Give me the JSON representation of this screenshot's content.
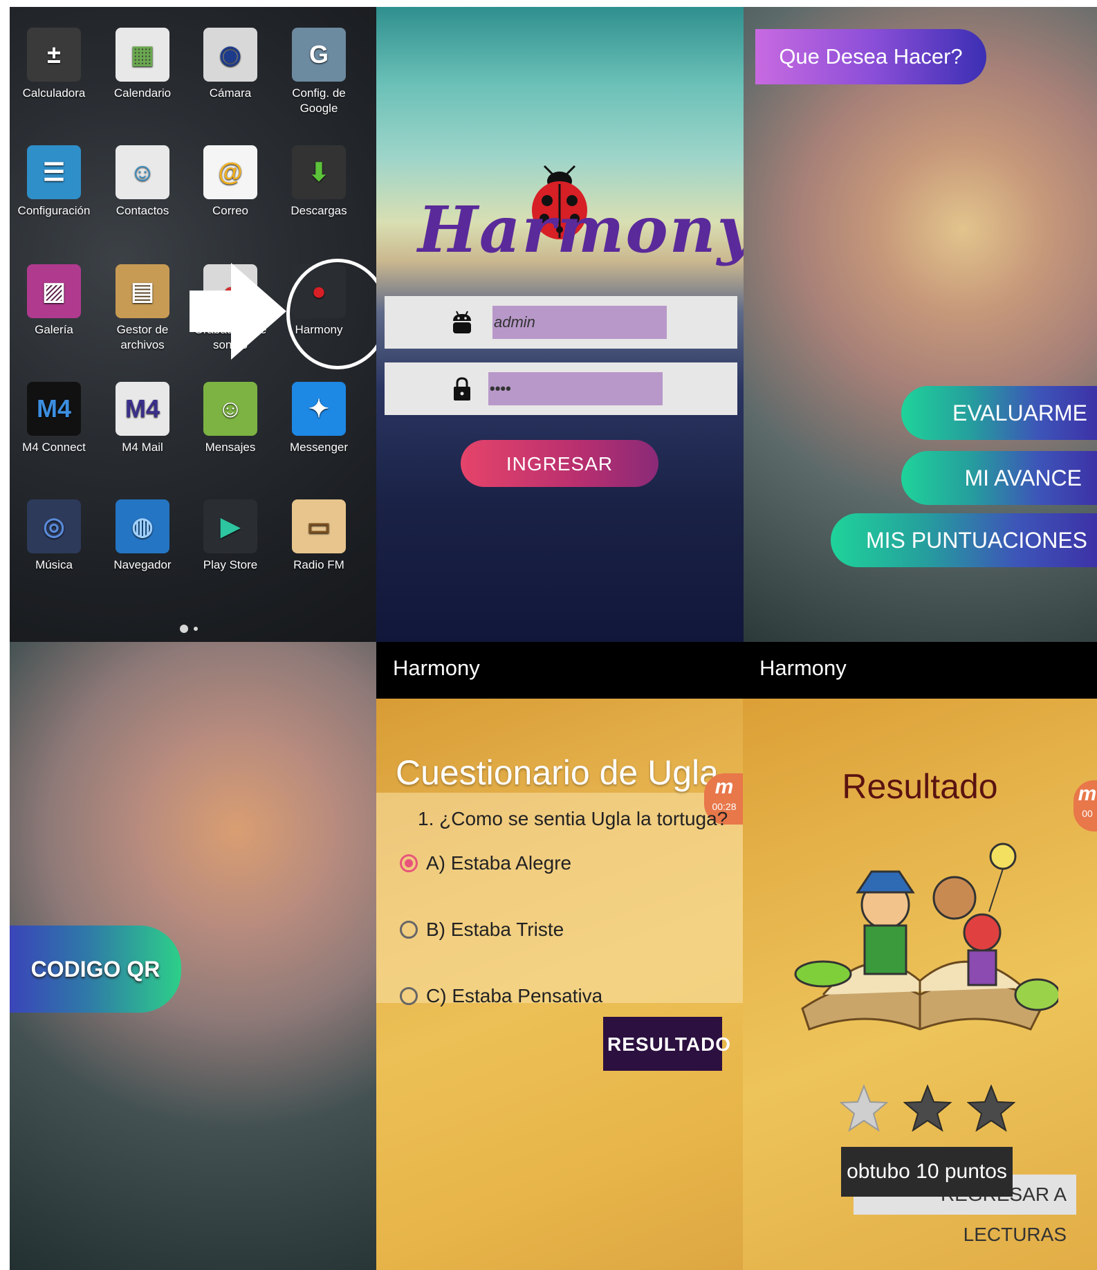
{
  "launcher": {
    "apps": [
      {
        "label": "Calculadora",
        "icon": "calculator-icon"
      },
      {
        "label": "Calendario",
        "icon": "calendar-icon"
      },
      {
        "label": "Cámara",
        "icon": "camera-icon"
      },
      {
        "label": "Config. de Google",
        "icon": "google-settings-icon"
      },
      {
        "label": "Configuración",
        "icon": "settings-icon"
      },
      {
        "label": "Contactos",
        "icon": "contacts-icon"
      },
      {
        "label": "Correo",
        "icon": "email-icon"
      },
      {
        "label": "Descargas",
        "icon": "downloads-icon"
      },
      {
        "label": "Galería",
        "icon": "gallery-icon"
      },
      {
        "label": "Gestor de archivos",
        "icon": "file-manager-icon"
      },
      {
        "label": "Grabadora de sonido",
        "icon": "sound-recorder-icon"
      },
      {
        "label": "Harmony",
        "icon": "ladybug-icon"
      },
      {
        "label": "M4 Connect",
        "icon": "m4-connect-icon"
      },
      {
        "label": "M4 Mail",
        "icon": "m4-mail-icon"
      },
      {
        "label": "Mensajes",
        "icon": "messages-icon"
      },
      {
        "label": "Messenger",
        "icon": "messenger-icon"
      },
      {
        "label": "Música",
        "icon": "music-icon"
      },
      {
        "label": "Navegador",
        "icon": "browser-icon"
      },
      {
        "label": "Play Store",
        "icon": "play-store-icon"
      },
      {
        "label": "Radio FM",
        "icon": "radio-icon"
      }
    ]
  },
  "login": {
    "logo_text": "Harmony",
    "username_value": "admin",
    "password_value": "••••",
    "submit_label": "INGRESAR"
  },
  "menu": {
    "heading": "Que Desea Hacer?",
    "buttons": [
      "EVALUARME",
      "MI AVANCE",
      "MIS PUNTUACIONES"
    ]
  },
  "qr": {
    "button_label": "CODIGO QR"
  },
  "quiz": {
    "app_title": "Harmony",
    "title": "Cuestionario de Ugla",
    "question": "1. ¿Como se sentia Ugla la tortuga?",
    "options": [
      "A) Estaba Alegre",
      "B) Estaba Triste",
      "C) Estaba Pensativa"
    ],
    "selected_index": 0,
    "submit_label": "RESULTADO",
    "timer": "00:28"
  },
  "result": {
    "app_title": "Harmony",
    "title": "Resultado",
    "stars_filled": 1,
    "stars_total": 3,
    "back_label": "REGRESAR A LECTURAS",
    "toast": "obtubo 10 puntos",
    "timer": "00"
  },
  "colors": {
    "login_button": "#e5446a",
    "menu_pill": "#8c4fd8",
    "menu_buttons": "#1fd39a",
    "result_button": "#2c1040",
    "radio_accent": "#e8557b"
  }
}
